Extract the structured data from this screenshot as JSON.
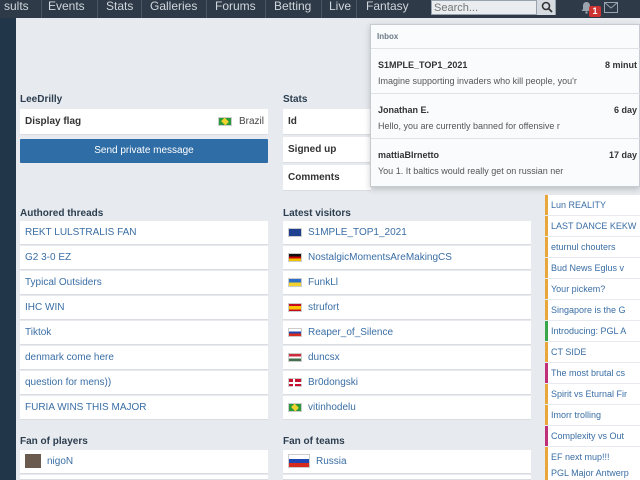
{
  "nav": {
    "items": [
      "sults",
      "Events",
      "Stats",
      "Galleries",
      "Forums",
      "Betting",
      "Live",
      "Fantasy"
    ],
    "search_placeholder": "Search...",
    "notification_count": "1"
  },
  "profile": {
    "username": "LeeDrilly",
    "display_flag_label": "Display flag",
    "country": "Brazil",
    "send_pm_label": "Send private message"
  },
  "stats": {
    "title": "Stats",
    "rows": [
      "Id",
      "Signed up",
      "Comments"
    ]
  },
  "authored_threads": {
    "title": "Authored threads",
    "items": [
      "REKT LULSTRALIS FAN",
      "G2 3-0 EZ",
      "Typical Outsiders",
      "IHC WIN",
      "Tiktok",
      "denmark come here",
      "question for mens))",
      "FURIA WINS THIS MAJOR"
    ]
  },
  "latest_visitors": {
    "title": "Latest visitors",
    "items": [
      {
        "name": "S1MPLE_TOP1_2021",
        "flag": "eu"
      },
      {
        "name": "NostalgicMomentsAreMakingCS",
        "flag": "de"
      },
      {
        "name": "FunkLl",
        "flag": "ua"
      },
      {
        "name": "strufort",
        "flag": "es"
      },
      {
        "name": "Reaper_of_Silence",
        "flag": "ru"
      },
      {
        "name": "duncsx",
        "flag": "hu"
      },
      {
        "name": "Br0dongski",
        "flag": "dk"
      },
      {
        "name": "vitinhodelu",
        "flag": "br"
      }
    ]
  },
  "fan_of_players": {
    "title": "Fan of players",
    "items": [
      "nigoN"
    ]
  },
  "fan_of_teams": {
    "title": "Fan of teams",
    "items": [
      "Russia"
    ]
  },
  "right_column": {
    "items": [
      "Lun REALITY",
      "LAST DANCE KEKW",
      "eturnul chouters",
      "Bud News Eglus v",
      "Your pickem?",
      "Singapore is the G",
      "Introducing: PGL A",
      "CT SIDE",
      "The most brutal cs",
      "Spirit vs Eturnal Fir",
      "Imorr trolling",
      "Complexity vs Out",
      "EF next mup!!!",
      "PGL Major Antwerp"
    ]
  },
  "inbox": {
    "title": "Inbox",
    "messages": [
      {
        "name": "S1MPLE_TOP1_2021",
        "time": "8 minut",
        "text": "Imagine supporting invaders who kill people, you'r"
      },
      {
        "name": "Jonathan E.",
        "time": "6 day",
        "text": "Hello, you are currently banned for offensive r"
      },
      {
        "name": "mattiaBIrnetto",
        "time": "17 day",
        "text": "You 1. It baltics would really get on russian ner"
      }
    ]
  },
  "colors": {
    "nav_bg": "#2e3a47",
    "accent_blue": "#2f6da6",
    "link": "#3a6ea5",
    "badge_red": "#cc3333"
  }
}
